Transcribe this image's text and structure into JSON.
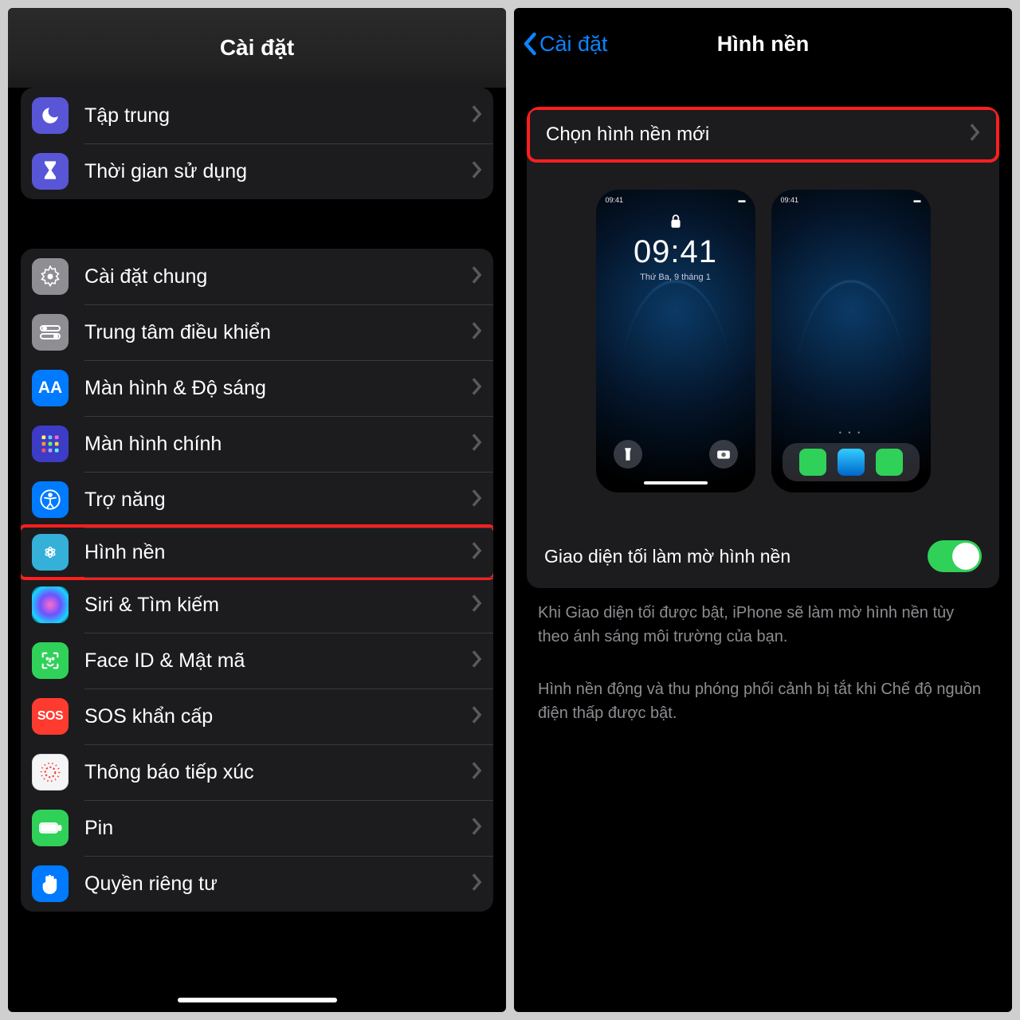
{
  "left": {
    "title": "Cài đặt",
    "group1": [
      {
        "label": "Tập trung"
      },
      {
        "label": "Thời gian sử dụng"
      }
    ],
    "group2": [
      {
        "label": "Cài đặt chung"
      },
      {
        "label": "Trung tâm điều khiển"
      },
      {
        "label": "Màn hình & Độ sáng"
      },
      {
        "label": "Màn hình chính"
      },
      {
        "label": "Trợ năng"
      },
      {
        "label": "Hình nền"
      },
      {
        "label": "Siri & Tìm kiếm"
      },
      {
        "label": "Face ID & Mật mã"
      },
      {
        "label": "SOS khẩn cấp"
      },
      {
        "label": "Thông báo tiếp xúc"
      },
      {
        "label": "Pin"
      },
      {
        "label": "Quyền riêng tư"
      }
    ]
  },
  "right": {
    "back": "Cài đặt",
    "title": "Hình nền",
    "choose": "Chọn hình nền mới",
    "preview_time": "09:41",
    "preview_date": "Thứ Ba, 9 tháng 1",
    "preview_status_time": "09:41",
    "toggle_label": "Giao diện tối làm mờ hình nền",
    "note1": "Khi Giao diện tối được bật, iPhone sẽ làm mờ hình nền tùy theo ánh sáng môi trường của bạn.",
    "note2": "Hình nền động và thu phóng phối cảnh bị tắt khi Chế độ nguồn điện thấp được bật."
  }
}
